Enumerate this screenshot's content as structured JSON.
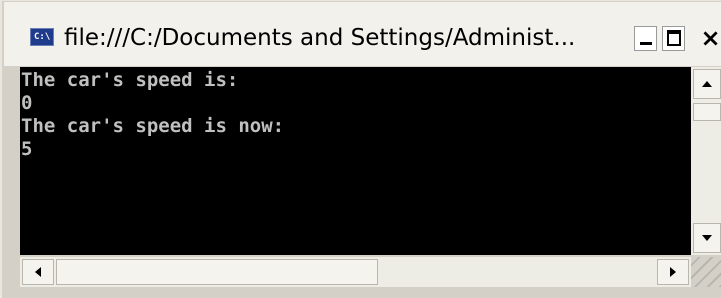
{
  "window": {
    "title": "file:///C:/Documents and Settings/Administ...",
    "icon": "console-icon",
    "icon_label": "C:\\"
  },
  "titlebar_buttons": {
    "minimize": "minimize-icon",
    "maximize": "maximize-icon",
    "close_label": "×"
  },
  "console": {
    "lines": [
      "The car's speed is:",
      "0",
      "The car's speed is now:",
      "5"
    ]
  },
  "colors": {
    "console_bg": "#000000",
    "console_fg": "#c0c0c0",
    "chrome": "#d4d0c8"
  }
}
